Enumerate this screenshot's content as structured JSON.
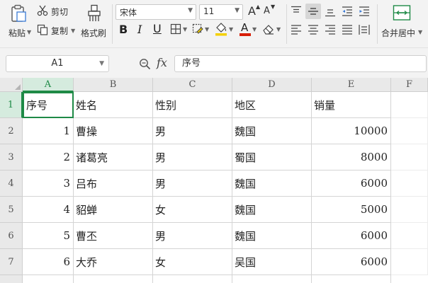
{
  "ribbon": {
    "clipboard": {
      "paste_label": "粘贴",
      "cut_label": "剪切",
      "copy_label": "复制",
      "format_painter_label": "格式刷"
    },
    "font": {
      "name": "宋体",
      "size": "11",
      "increase_size_glyph": "A",
      "decrease_size_glyph": "A",
      "bold_glyph": "B",
      "italic_glyph": "I",
      "underline_glyph": "U",
      "font_color_glyph": "A",
      "font_color": "#d81e06",
      "fill_color": "#f4d000"
    },
    "alignment": {
      "merge_center_label": "合并居中"
    }
  },
  "formula_bar": {
    "name_box": "A1",
    "fx_label": "fx",
    "content": "序号"
  },
  "sheet": {
    "columns": [
      "A",
      "B",
      "C",
      "D",
      "E",
      "F"
    ],
    "row_numbers": [
      "1",
      "2",
      "3",
      "4",
      "5",
      "6",
      "7"
    ],
    "header": [
      "序号",
      "姓名",
      "性别",
      "地区",
      "销量"
    ],
    "rows": [
      [
        "1",
        "曹操",
        "男",
        "魏国",
        "10000"
      ],
      [
        "2",
        "诸葛亮",
        "男",
        "蜀国",
        "8000"
      ],
      [
        "3",
        "吕布",
        "男",
        "魏国",
        "6000"
      ],
      [
        "4",
        "貂蝉",
        "女",
        "魏国",
        "5000"
      ],
      [
        "5",
        "曹丕",
        "男",
        "魏国",
        "6000"
      ],
      [
        "6",
        "大乔",
        "女",
        "吴国",
        "6000"
      ]
    ],
    "selected_cell": "A1",
    "accent_color": "#1e8a46"
  }
}
